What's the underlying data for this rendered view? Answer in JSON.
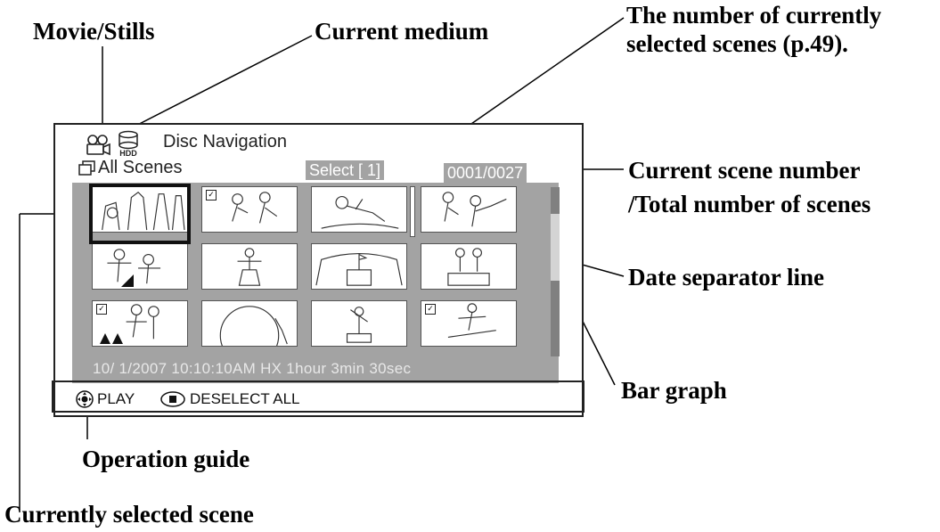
{
  "callouts": {
    "movie_stills": "Movie/Stills",
    "current_medium": "Current medium",
    "selected_count_line1": "The number of currently",
    "selected_count_line2": "selected scenes (p.49).",
    "scene_number_line1": "Current scene number",
    "scene_number_line2": "/Total number of scenes",
    "date_separator": "Date separator line",
    "bar_graph": "Bar graph",
    "operation_guide": "Operation guide",
    "currently_selected": "Currently selected scene"
  },
  "screen": {
    "title": "Disc  Navigation",
    "medium_badge": "HDD",
    "view_label": "All Scenes",
    "select_label": "Select [   1]",
    "scene_counter": "0001/0027",
    "status_line": "10/  1/2007   10:10:10AM   HX  1hour 3min 30sec",
    "guide": {
      "play_label": "PLAY",
      "deselect_label": "DESELECT ALL"
    },
    "scrollbar_position": 0.25
  },
  "colors": {
    "panel": "#a3a3a3",
    "frame": "#222222"
  }
}
